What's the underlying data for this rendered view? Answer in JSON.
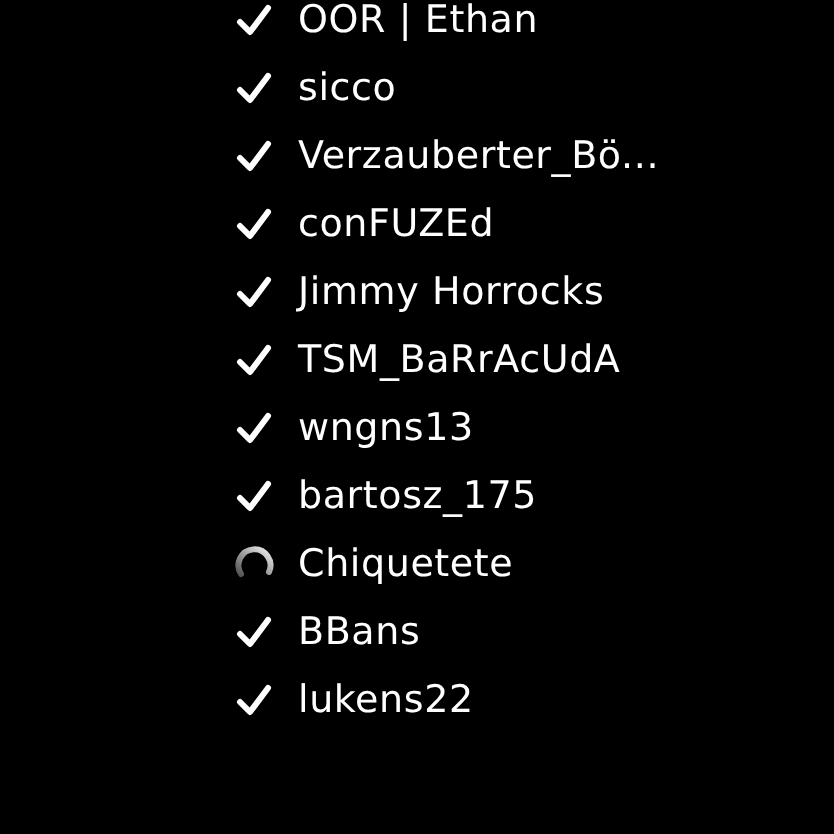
{
  "players": [
    {
      "name": "OOR | Ethan",
      "kind": "ready"
    },
    {
      "name": "sicco",
      "kind": "ready"
    },
    {
      "name": "Verzauberter_Bö...",
      "kind": "ready"
    },
    {
      "name": "conFUZEd",
      "kind": "ready"
    },
    {
      "name": "Jimmy Horrocks",
      "kind": "ready"
    },
    {
      "name": "TSM_BaRrAcUdA",
      "kind": "ready"
    },
    {
      "name": "wngns13",
      "kind": "ready"
    },
    {
      "name": "bartosz_175",
      "kind": "ready"
    },
    {
      "name": "Chiquetete",
      "kind": "loading"
    },
    {
      "name": "BBans",
      "kind": "ready"
    },
    {
      "name": "lukens22",
      "kind": "ready"
    }
  ]
}
